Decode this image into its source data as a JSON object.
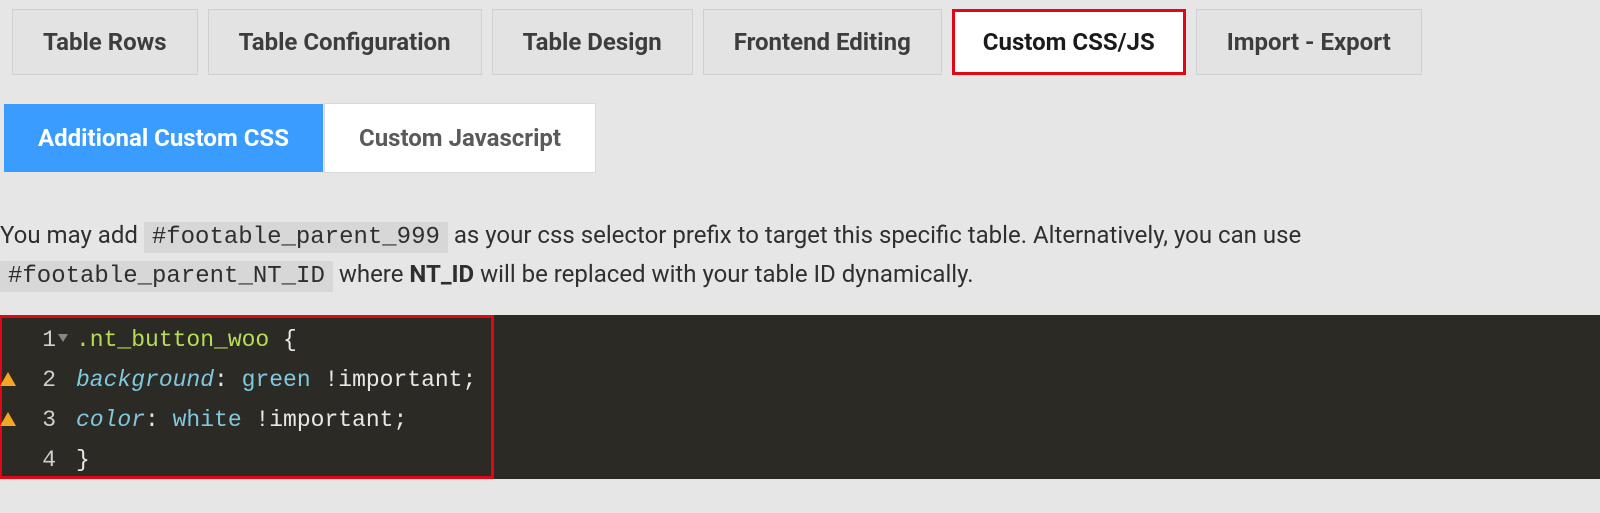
{
  "top_tabs": {
    "rows": "Table Rows",
    "config": "Table Configuration",
    "design": "Table Design",
    "frontend": "Frontend Editing",
    "cssjs": "Custom CSS/JS",
    "import": "Import - Export"
  },
  "sub_tabs": {
    "css": "Additional Custom CSS",
    "js": "Custom Javascript"
  },
  "help": {
    "lead": "You may add ",
    "code1": "#footable_parent_999",
    "mid1": " as your css selector prefix to target this specific table. Alternatively, you can use ",
    "code2": "#footable_parent_NT_ID",
    "mid2": " where ",
    "bold": "NT_ID",
    "tail": " will be replaced with your table ID dynamically."
  },
  "editor": {
    "gutter": {
      "l1": "1",
      "l2": "2",
      "l3": "3",
      "l4": "4"
    },
    "l1": {
      "sel": ".nt_button_woo",
      "br": " {"
    },
    "l2": {
      "prop": "background",
      "colon": ": ",
      "val": "green",
      "imp": " !important;"
    },
    "l3": {
      "prop": "color",
      "colon": ": ",
      "val": "white",
      "imp": " !important;"
    },
    "l4": {
      "br": "}"
    }
  }
}
